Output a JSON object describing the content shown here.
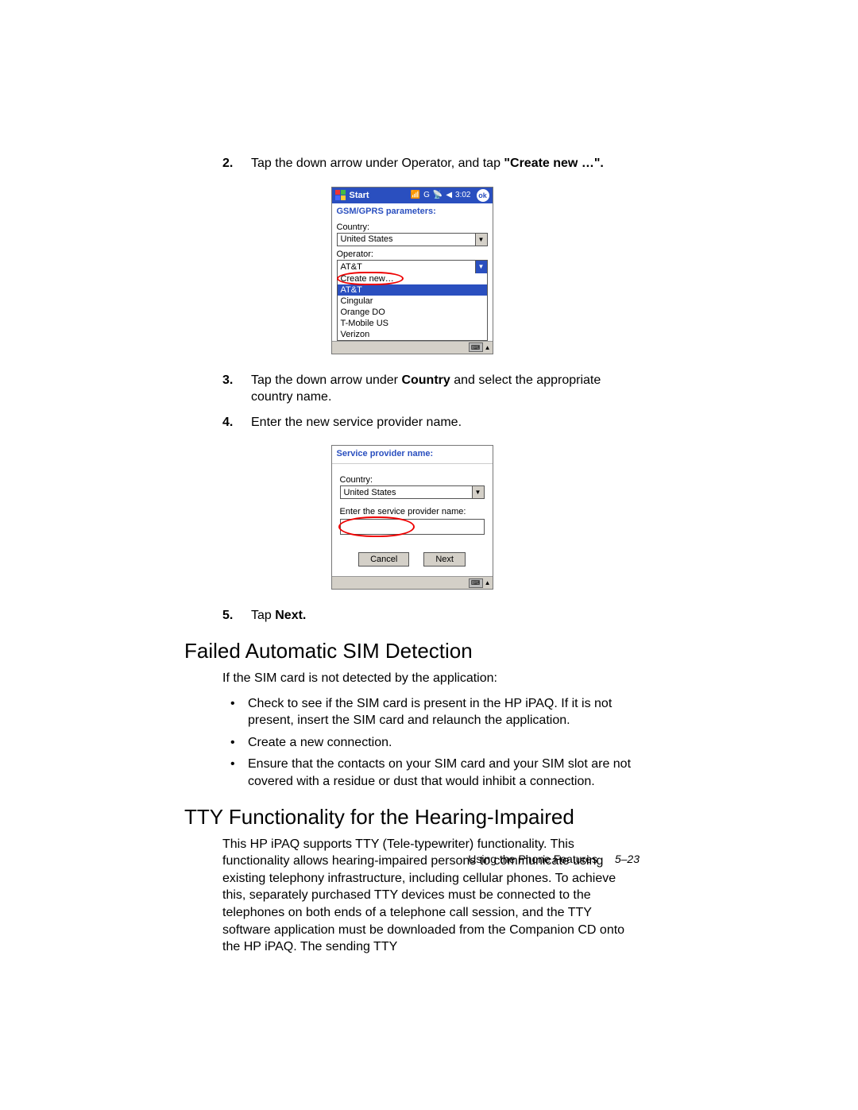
{
  "steps": {
    "s2": {
      "num": "2.",
      "pre": "Tap the down arrow under Operator, and tap ",
      "bold": "\"Create new …\"."
    },
    "s3": {
      "num": "3.",
      "pre": "Tap the down arrow under ",
      "bold": "Country",
      "post": " and select the appropriate country name."
    },
    "s4": {
      "num": "4.",
      "txt": "Enter the new service provider name."
    },
    "s5": {
      "num": "5.",
      "pre": "Tap ",
      "bold": "Next."
    }
  },
  "shot1": {
    "start": "Start",
    "time": "3:02",
    "ok": "ok",
    "title": "GSM/GPRS parameters:",
    "country_lbl": "Country:",
    "country_val": "United States",
    "operator_lbl": "Operator:",
    "operator_val": "AT&T",
    "options": {
      "create": "Create new…",
      "att": "AT&T",
      "cingular": "Cingular",
      "orange": "Orange DO",
      "tmobile": "T-Mobile US",
      "verizon": "Verizon"
    }
  },
  "shot2": {
    "title": "Service provider name:",
    "country_lbl": "Country:",
    "country_val": "United States",
    "enter_lbl": "Enter the service provider name:",
    "cancel": "Cancel",
    "next": "Next"
  },
  "sec1": {
    "h": "Failed Automatic SIM Detection",
    "intro": "If the SIM card is not detected by the application:",
    "b1": "Check to see if the SIM card is present in the HP iPAQ. If it is not present, insert the SIM card and relaunch the application.",
    "b2": "Create a new connection.",
    "b3": "Ensure that the contacts on your SIM card and your SIM slot are not covered with a residue or dust that would inhibit a connection."
  },
  "sec2": {
    "h": "TTY Functionality for the Hearing-Impaired",
    "p": "This HP iPAQ supports TTY (Tele-typewriter) functionality. This functionality allows hearing-impaired persons to communicate using existing telephony infrastructure, including cellular phones. To achieve this, separately purchased TTY devices must be connected to the telephones on both ends of a telephone call session, and the TTY software application must be downloaded from the Companion CD onto the HP iPAQ. The sending TTY"
  },
  "footer": {
    "label": "Using the Phone Features",
    "page": "5–23"
  }
}
